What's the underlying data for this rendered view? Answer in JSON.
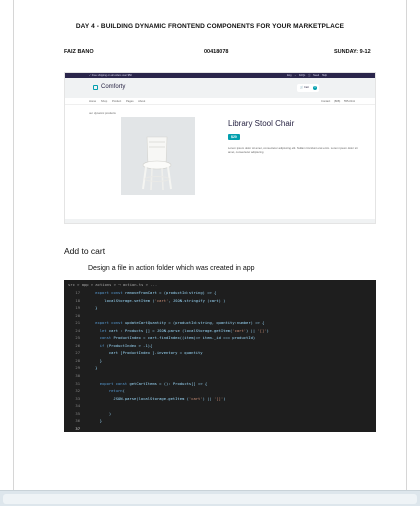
{
  "document": {
    "title": "DAY 4 - BUILDING DYNAMIC FRONTEND COMPONENTS FOR YOUR MARKETPLACE",
    "author": "FAIZ BANO",
    "student_id": "00418078",
    "schedule": "SUNDAY: 9-12"
  },
  "website": {
    "topbar_left": "✓ Free shipping on all orders over $50",
    "topbar_right": "Eng ⌄  FAQs  ⓘ Need Help",
    "logo": "Comforty",
    "cart_label": "Cart",
    "cart_count": "0",
    "nav_links": "Home Shop Product Pages About",
    "nav_contact": "Contact (808) 555-0111",
    "breadcrumb": "our dynamic products",
    "product_title": "Library Stool Chair",
    "price": "$20",
    "description": "Lorem ipsum dolor sit amet, consectetur adipiscing elit. Nullam tincidunt erat enim. Lorem ipsum dolor sit amet, consectetur adipiscing",
    "colors": {
      "brand": "#029fae",
      "topbar": "#2a254b",
      "header_bg": "#f0f2f3"
    }
  },
  "section": {
    "title": "Add to cart",
    "subtitle": "Design a file in action folder which was created in app"
  },
  "code_editor": {
    "breadcrumb": "src > app > actions > ⟶ action.ts > ...",
    "lines": [
      {
        "n": "17",
        "text": "    export const removeFromCart = (productId:string) => {"
      },
      {
        "n": "18",
        "text": "        localStorage.setItem ('cart', JSON.stringify (cart) )"
      },
      {
        "n": "19",
        "text": "    }"
      },
      {
        "n": "20",
        "text": ""
      },
      {
        "n": "21",
        "text": "    export const updateCartQuantity = (productId:string, quantity:number) => {"
      },
      {
        "n": "24",
        "text": "      let cart : Products [] = JSON.parse (localStorage.getItem('cart') || '[]')"
      },
      {
        "n": "25",
        "text": "      const ProductIndex = cart.findIndex((item)=> item._id === productId)"
      },
      {
        "n": "26",
        "text": "      if (ProductIndex > -1){"
      },
      {
        "n": "27",
        "text": "          cart [ProductIndex ].inventory = quantity"
      },
      {
        "n": "28",
        "text": "      }"
      },
      {
        "n": "29",
        "text": "    }"
      },
      {
        "n": "30",
        "text": ""
      },
      {
        "n": "31",
        "text": "      export const getCartItems = (): Products[] => {"
      },
      {
        "n": "32",
        "text": "          return("
      },
      {
        "n": "33",
        "text": "            JSON.parse(localStorage.getItem ('cart') || '[]')"
      },
      {
        "n": "34",
        "text": ""
      },
      {
        "n": "35",
        "text": "          )"
      },
      {
        "n": "36",
        "text": "      }"
      },
      {
        "n": "37",
        "text": ""
      }
    ],
    "colors": {
      "background": "#1e1e1e",
      "keyword": "#569cd6",
      "string": "#ce9178",
      "text": "#9cdcfe"
    }
  }
}
